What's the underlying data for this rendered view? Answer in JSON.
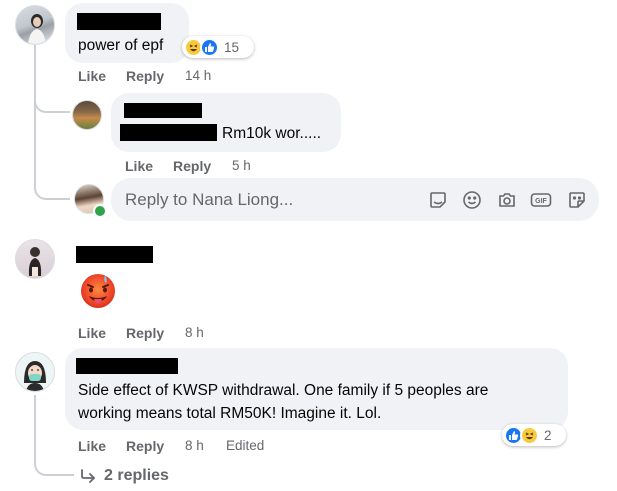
{
  "comments": [
    {
      "text": "power of epf",
      "reaction_count": "15",
      "actions": {
        "like": "Like",
        "reply": "Reply",
        "time": "14 h"
      }
    },
    {
      "text": "Rm10k wor.....",
      "actions": {
        "like": "Like",
        "reply": "Reply",
        "time": "5 h"
      }
    },
    {
      "actions": {
        "like": "Like",
        "reply": "Reply",
        "time": "8 h"
      }
    },
    {
      "text_line1": "Side effect of KWSP withdrawal. One family if 5 peoples are",
      "text_line2": "working means total RM50K! Imagine it. Lol.",
      "reaction_count": "2",
      "actions": {
        "like": "Like",
        "reply": "Reply",
        "time": "8 h",
        "edited": "Edited"
      }
    }
  ],
  "reply_box": {
    "placeholder": "Reply to Nana Liong...",
    "tools": [
      "sticker-face-icon",
      "emoji-icon",
      "camera-icon",
      "gif-icon",
      "sticker-icon"
    ]
  },
  "view_replies": "2 replies",
  "colors": {
    "bubble": "#f0f2f5",
    "secondary_text": "#65676b",
    "like_blue": "#1877f2",
    "haha_yellow": "#f7c93d",
    "online_green": "#31a24c"
  }
}
